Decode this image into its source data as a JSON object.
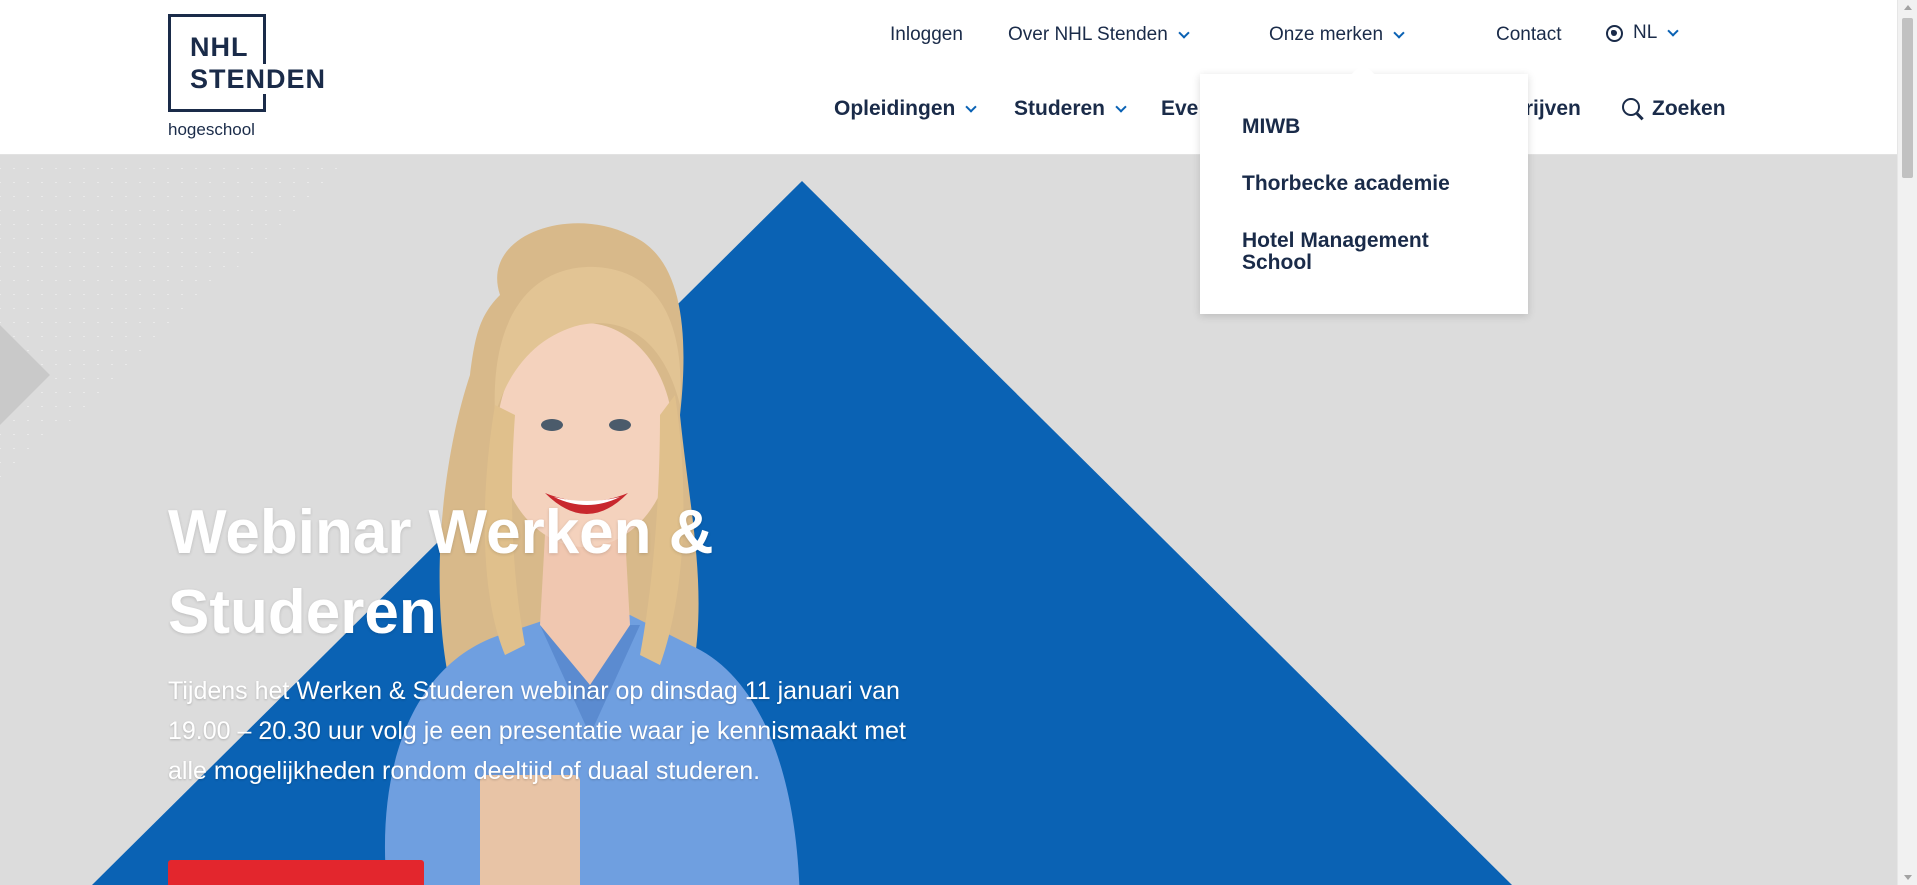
{
  "logo": {
    "line1": "NHL",
    "line2": "STENDEN",
    "sub": "hogeschool"
  },
  "topnav": {
    "login": "Inloggen",
    "about": "Over NHL Stenden",
    "brands": "Onze merken",
    "contact": "Contact",
    "language": "NL"
  },
  "mainnav": {
    "programs": "Opleidingen",
    "study": "Studeren",
    "events_partial": "Eve",
    "business_partial": "drijven",
    "search": "Zoeken"
  },
  "dropdown": {
    "items": [
      "MIWB",
      "Thorbecke academie",
      "Hotel Management School"
    ]
  },
  "hero": {
    "title": "Webinar Werken & Studeren",
    "text": "Tijdens het Werken & Studeren webinar op dinsdag 11 januari van 19.00 – 20.30 uur volg je een presentatie waar je kennismaakt met alle mogelijkheden rondom deeltijd of duaal studeren."
  },
  "colors": {
    "navy": "#1a2b49",
    "accent_blue": "#0a62b4",
    "hero_bg": "#dcdcdc",
    "cta_red": "#e3262d"
  }
}
